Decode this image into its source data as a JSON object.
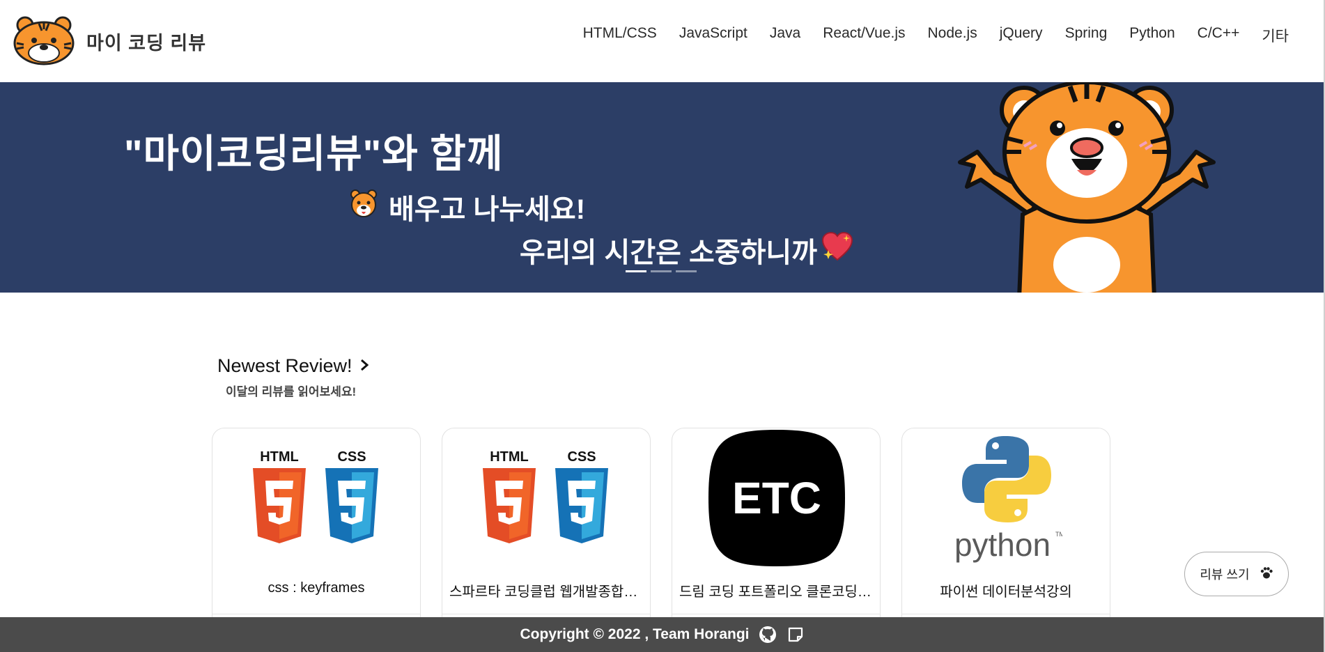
{
  "header": {
    "brand": "마이 코딩 리뷰",
    "logo": "tiger-face-icon",
    "nav": [
      "HTML/CSS",
      "JavaScript",
      "Java",
      "React/Vue.js",
      "Node.js",
      "jQuery",
      "Spring",
      "Python",
      "C/C++",
      "기타"
    ]
  },
  "hero": {
    "title": "\"마이코딩리뷰\"와 함께",
    "line2": "배우고 나누세요!",
    "line3": "우리의 시간은 소중하니까",
    "line2_icon": "tiger-face-icon",
    "line3_icon": "sparkling-heart-icon",
    "slide_count": 3,
    "active_slide": 1,
    "mascot": "tiger-mascot",
    "background": "#2c3e66"
  },
  "reviews": {
    "title": "Newest Review!",
    "subtitle": "이달의 리뷰를 읽어보세요!",
    "cards": [
      {
        "title": "css : keyframes",
        "image": "html-css-logo"
      },
      {
        "title": "스파르타 코딩클럽 웹개발종합반...",
        "image": "html-css-logo"
      },
      {
        "title": "드림 코딩 포트폴리오 클론코딩 ...",
        "image": "etc-logo",
        "image_text": "ETC"
      },
      {
        "title": "파이썬 데이터분석강의",
        "image": "python-logo",
        "image_text": "python"
      }
    ]
  },
  "write_button": {
    "label": "리뷰 쓰기",
    "icon": "paw-icon"
  },
  "footer": {
    "copyright": "Copyright © 2022 , Team Horangi",
    "icons": [
      "github-icon",
      "note-icon"
    ]
  },
  "colors": {
    "banner": "#2c3e66",
    "footer": "#4b4b4b",
    "tiger_orange": "#f7952e",
    "html_orange": "#e44d26",
    "css_blue": "#1572b6"
  }
}
